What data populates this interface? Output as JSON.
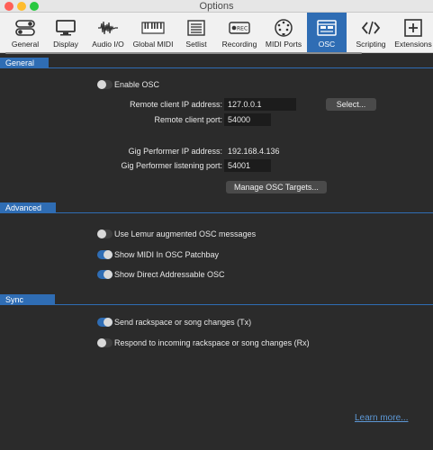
{
  "window": {
    "title": "Options"
  },
  "toolbar": {
    "tabs": [
      {
        "label": "General",
        "icon": "toggles-icon"
      },
      {
        "label": "Display",
        "icon": "monitor-icon"
      },
      {
        "label": "Audio I/O",
        "icon": "waveform-icon"
      },
      {
        "label": "Global MIDI",
        "icon": "piano-keys-icon"
      },
      {
        "label": "Setlist",
        "icon": "list-icon"
      },
      {
        "label": "Recording",
        "icon": "rec-icon",
        "icon_text": "REC"
      },
      {
        "label": "MIDI Ports",
        "icon": "midi-connector-icon"
      },
      {
        "label": "OSC",
        "icon": "osc-icon",
        "active": true
      },
      {
        "label": "Scripting",
        "icon": "code-icon"
      },
      {
        "label": "Extensions",
        "icon": "plus-box-icon"
      }
    ]
  },
  "sections": {
    "general": "General",
    "advanced": "Advanced",
    "sync": "Sync"
  },
  "general": {
    "enable_osc": {
      "label": "Enable OSC",
      "on": false
    },
    "remote_ip_label": "Remote client IP address:",
    "remote_ip_value": "127.0.0.1",
    "select_button": "Select...",
    "remote_port_label": "Remote client port:",
    "remote_port_value": "54000",
    "gp_ip_label": "Gig Performer IP address:",
    "gp_ip_value": "192.168.4.136",
    "gp_port_label": "Gig Performer listening port:",
    "gp_port_value": "54001",
    "manage_button": "Manage OSC Targets..."
  },
  "advanced": {
    "lemur": {
      "label": "Use Lemur augmented OSC messages",
      "on": false
    },
    "show_midi": {
      "label": "Show MIDI In OSC Patchbay",
      "on": true
    },
    "direct_osc": {
      "label": "Show Direct Addressable OSC",
      "on": true
    }
  },
  "sync": {
    "send": {
      "label": "Send rackspace or song changes (Tx)",
      "on": true
    },
    "respond": {
      "label": "Respond to incoming rackspace or song changes (Rx)",
      "on": false
    }
  },
  "footer": {
    "learn_more": "Learn more..."
  },
  "colors": {
    "accent": "#2f6db4",
    "background": "#2b2b2b",
    "link": "#5d98d6"
  }
}
